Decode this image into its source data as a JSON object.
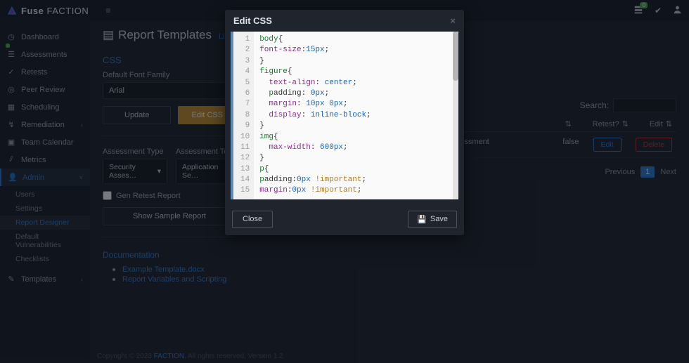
{
  "brand": {
    "a": "Fuse",
    "b": "FACTION"
  },
  "topbar": {
    "queue_badge": "0"
  },
  "sidebar": {
    "items": [
      {
        "icon": "◷",
        "label": "Dashboard"
      },
      {
        "icon": "☰",
        "label": "Assessments"
      },
      {
        "icon": "✓",
        "label": "Retests"
      },
      {
        "icon": "◎",
        "label": "Peer Review"
      },
      {
        "icon": "▦",
        "label": "Scheduling"
      },
      {
        "icon": "↯",
        "label": "Remediation"
      },
      {
        "icon": "▣",
        "label": "Team Calendar"
      },
      {
        "icon": "⫽",
        "label": "Metrics"
      },
      {
        "icon": "👤",
        "label": "Admin"
      }
    ],
    "admin_sub": [
      "Users",
      "Settings",
      "Report Designer",
      "Default Vulnerabilities",
      "Checklists"
    ],
    "templates_label": "Templates"
  },
  "page": {
    "title": "Report Templates",
    "subtitle": "Listing of Report",
    "css_section": "CSS",
    "font_label": "Default Font Family",
    "font_value": "Arial",
    "update_btn": "Update",
    "editcss_btn": "Edit CSS",
    "assess_type_label": "Assessment Type",
    "assess_type_value": "Security Asses…",
    "assess_team_label": "Assessment Team",
    "assess_team_value": "Application Se…",
    "gen_retest": "Gen Retest Report",
    "show_sample": "Show Sample Report",
    "doc_head": "Documentation",
    "doc_links": [
      "Example Template.docx",
      "Report Variables and Scripting"
    ]
  },
  "table": {
    "search_label": "Search:",
    "cols": {
      "type": "y Assessment",
      "retest": "Retest?",
      "edit": "Edit"
    },
    "row": {
      "retest": "false",
      "edit": "Edit",
      "del": "Delete"
    },
    "pager": {
      "prev": "Previous",
      "cur": "1",
      "next": "Next"
    }
  },
  "footer": {
    "copy": "Copyright © 2023 ",
    "link": "FACTION",
    "rest": ". All rights reserved. Version 1.2"
  },
  "modal": {
    "title": "Edit CSS",
    "close_btn": "Close",
    "save_btn": "Save",
    "lines": [
      "body{",
      "font-size:15px;",
      "}",
      "figure{",
      "  text-align: center;",
      "  padding: 0px;",
      "  margin: 10px 0px;",
      "  display: inline-block;",
      "}",
      "img{",
      "  max-width: 600px;",
      "}",
      "p{",
      "padding:0px !important;",
      "margin:0px !important;"
    ]
  }
}
